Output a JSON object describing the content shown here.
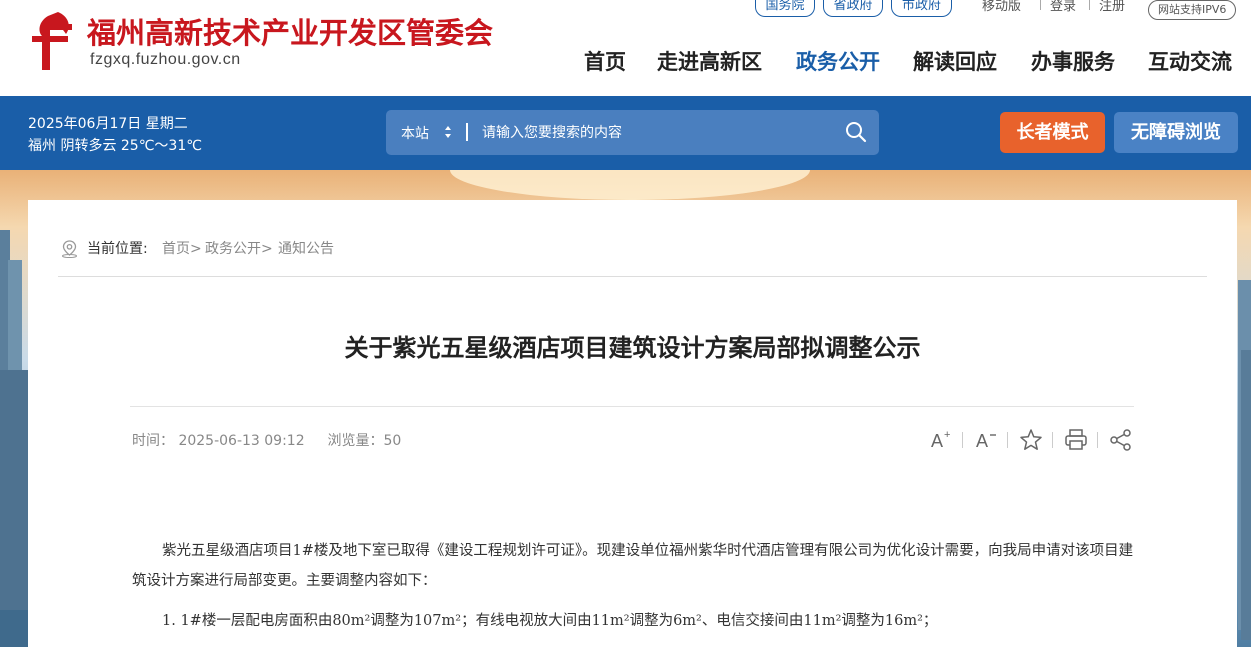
{
  "header": {
    "site_title": "福州高新技术产业开发区管委会",
    "site_url": "fzgxq.fuzhou.gov.cn",
    "gov_links": [
      "国务院",
      "省政府",
      "市政府"
    ],
    "mobile": "移动版",
    "login": "登录",
    "register": "注册",
    "ipv6": "网站支持IPV6",
    "nav": [
      "首页",
      "走进高新区",
      "政务公开",
      "解读回应",
      "办事服务",
      "互动交流"
    ],
    "active_nav": "政务公开"
  },
  "bar": {
    "date": "2025年06月17日 星期二",
    "weather": "福州 阴转多云 25℃～31℃",
    "search_scope": "本站",
    "search_placeholder": "请输入您要搜索的内容",
    "elder_mode": "长者模式",
    "accessible": "无障碍浏览"
  },
  "breadcrumb": {
    "label": "当前位置:",
    "items": [
      "首页>",
      "政务公开>",
      "通知公告"
    ]
  },
  "article": {
    "title": "关于紫光五星级酒店项目建筑设计方案局部拟调整公示",
    "time": "时间： 2025-06-13 09:12",
    "views": "浏览量：50",
    "para1": "紫光五星级酒店项目1#楼及地下室已取得《建设工程规划许可证》。现建设单位福州紫华时代酒店管理有限公司为优化设计需要，向我局申请对该项目建筑设计方案进行局部变更。主要调整内容如下：",
    "para2": "1. 1#楼一层配电房面积由80m²调整为107m²；有线电视放大间由11m²调整为6m²、电信交接间由11m²调整为16m²；"
  },
  "colors": {
    "brand_red": "#c8171e",
    "brand_blue": "#1a5ea8",
    "elder_orange": "#e8622c"
  }
}
